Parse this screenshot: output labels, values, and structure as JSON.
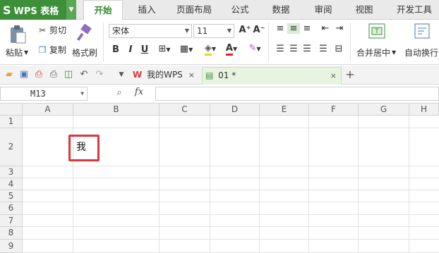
{
  "app": {
    "name": "WPS 表格",
    "logo": "S"
  },
  "menu": {
    "tabs": [
      "开始",
      "插入",
      "页面布局",
      "公式",
      "数据",
      "审阅",
      "视图",
      "开发工具"
    ],
    "active": "开始"
  },
  "ribbon": {
    "paste_label": "粘贴",
    "cut_label": "剪切",
    "copy_label": "复制",
    "format_painter_label": "格式刷",
    "font_name": "宋体",
    "font_size": "11",
    "bold": "B",
    "italic": "I",
    "underline": "U",
    "merge_label": "合并居中",
    "wrap_label": "自动换行",
    "grow_font": "A⁺",
    "shrink_font": "A⁻"
  },
  "doc_tabs": [
    {
      "label": "我的WPS",
      "close": "×"
    },
    {
      "label": "01 *",
      "close": "×"
    }
  ],
  "new_tab": "+",
  "formula_bar": {
    "name_box": "M13",
    "fx": "fx",
    "value": ""
  },
  "sheet": {
    "columns": [
      "A",
      "B",
      "C",
      "D",
      "E",
      "F",
      "G",
      "H"
    ],
    "rows": [
      "1",
      "2",
      "3",
      "4",
      "5",
      "6",
      "7",
      "8",
      "9"
    ],
    "cells": {
      "B2": "我"
    }
  },
  "colors": {
    "accent": "#3d8f3a",
    "highlight": "#d9373a"
  }
}
